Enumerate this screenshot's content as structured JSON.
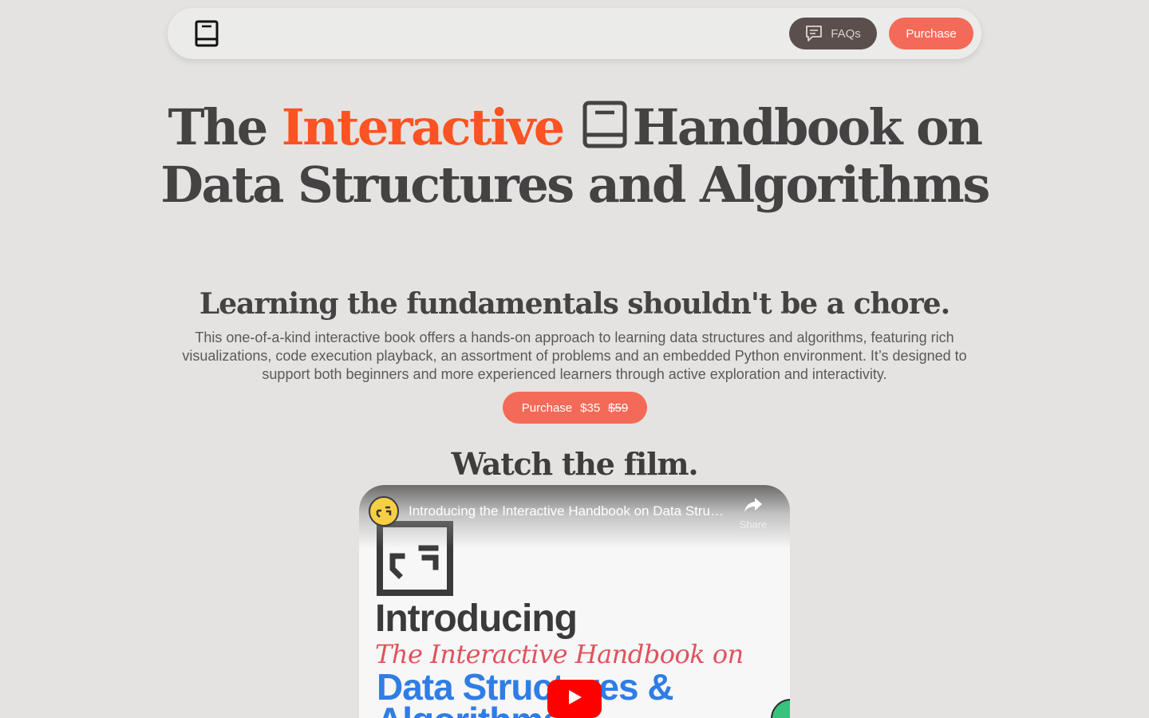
{
  "nav": {
    "logo_icon": "book-icon",
    "faq_icon": "chat-bubble-icon",
    "faq_label": "FAQs",
    "purchase_label": "Purchase"
  },
  "hero": {
    "title_prefix": "The",
    "title_accent": "Interactive",
    "title_icon": "book-icon",
    "title_suffix": "Handbook on Data Structures and Algorithms",
    "subtitle": "Learning the fundamentals shouldn't be a chore.",
    "description": "This one-of-a-kind interactive book offers a hands-on approach to learning data structures and algorithms, featuring rich visualizations, code execution playback, an assortment of problems and an embedded Python environment. It’s designed to support both beginners and more experienced learners through active exploration and interactivity.",
    "purchase_label": "Purchase",
    "price": "$35",
    "old_price": "$59"
  },
  "film": {
    "heading": "Watch the film.",
    "video_title": "Introducing the Interactive Handbook on Data Structures & Algorithms",
    "share_label": "Share",
    "share_icon": "share-arrow-icon",
    "play_icon": "play-icon",
    "thumb_intro": "Introducing",
    "thumb_script": "The Interactive Handbook on",
    "thumb_ds": "Data Structures &",
    "thumb_algo": "Algorithms"
  },
  "colors": {
    "accent_orange": "#fb5323",
    "button_coral": "#f46a58",
    "faq_bg": "#5a4f4c",
    "page_bg": "#e4e3e1",
    "heading": "#444242"
  }
}
